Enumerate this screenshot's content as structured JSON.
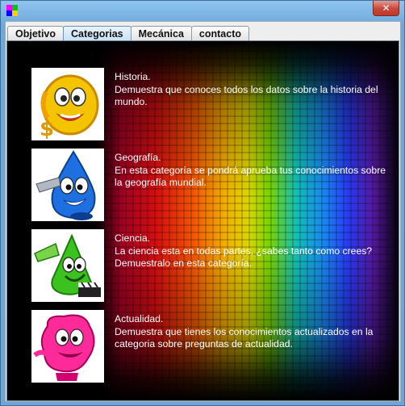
{
  "window": {
    "title": "",
    "close_glyph": "✕",
    "icon_colors": [
      "#ff00ff",
      "#00c800",
      "#0000ff",
      "#ffd000"
    ]
  },
  "tabs": [
    {
      "label": "Objetivo",
      "active": false
    },
    {
      "label": "Categorias",
      "active": true
    },
    {
      "label": "Mecánica",
      "active": false
    },
    {
      "label": "contacto",
      "active": false
    }
  ],
  "categories": [
    {
      "title": "Historia.",
      "description": "Demuestra que conoces todos los datos sobre la historia del mundo.",
      "mascot_color": "#f5c400",
      "mascot_icon": "dollar-mascot-icon"
    },
    {
      "title": "Geografía.",
      "description": "En esta categoría se pondrá aprueba tus conocimientos sobre la geografía mundial.",
      "mascot_color": "#1e6fe0",
      "mascot_icon": "drop-mascot-icon"
    },
    {
      "title": "Ciencia.",
      "description": "La ciencia esta en todas partes, ¿sabes tanto como crees? Demuestralo en esta categoría.",
      "mascot_color": "#3cc21e",
      "mascot_icon": "green-mascot-icon"
    },
    {
      "title": "Actualidad.",
      "description": "Demuestra que tienes los conocimientos actualizados en la categoria sobre preguntas de actualidad.",
      "mascot_color": "#ff2a9a",
      "mascot_icon": "pink-mascot-icon"
    }
  ]
}
